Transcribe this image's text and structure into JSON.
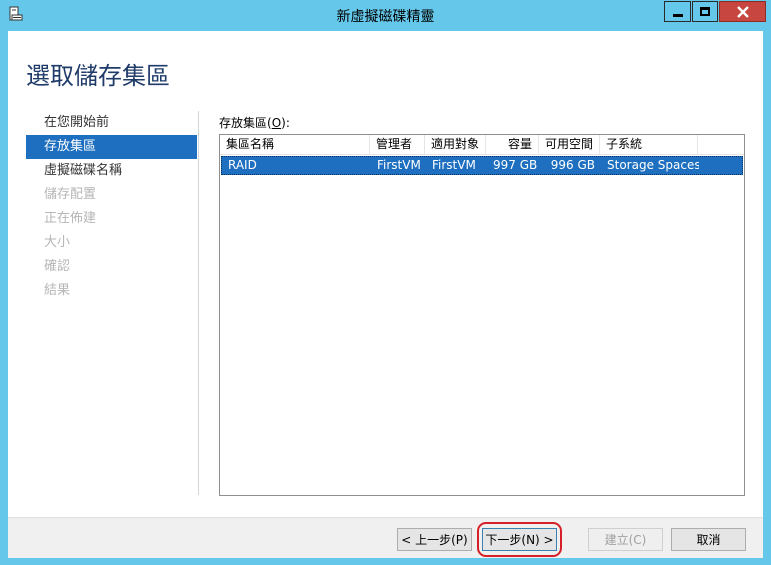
{
  "window": {
    "title": "新虛擬磁碟精靈",
    "accent_color": "#65c8ea",
    "close_color": "#c7463f",
    "icons": [
      "app-icon",
      "minimize-icon",
      "maximize-icon",
      "close-icon"
    ]
  },
  "header": {
    "title": "選取儲存集區"
  },
  "steps": [
    {
      "label": "在您開始前",
      "state": "normal"
    },
    {
      "label": "存放集區",
      "state": "active"
    },
    {
      "label": "虛擬磁碟名稱",
      "state": "normal"
    },
    {
      "label": "儲存配置",
      "state": "disabled"
    },
    {
      "label": "正在佈建",
      "state": "disabled"
    },
    {
      "label": "大小",
      "state": "disabled"
    },
    {
      "label": "確認",
      "state": "disabled"
    },
    {
      "label": "結果",
      "state": "disabled"
    }
  ],
  "pool": {
    "label_prefix": "存放集區(",
    "label_key": "O",
    "label_suffix": "):",
    "columns": [
      "集區名稱",
      "管理者",
      "適用對象",
      "容量",
      "可用空間",
      "子系統"
    ],
    "rows": [
      {
        "name": "RAID",
        "managed_by": "FirstVM",
        "available_to": "FirstVM",
        "capacity": "997 GB",
        "free_space": "996 GB",
        "subsystem": "Storage Spaces",
        "selected": true
      }
    ],
    "selection_color": "#1e6fbf"
  },
  "footer": {
    "back": "< 上一步(P)",
    "next": "下一步(N) >",
    "create": "建立(C)",
    "cancel": "取消",
    "highlight_color": "#d62029"
  }
}
